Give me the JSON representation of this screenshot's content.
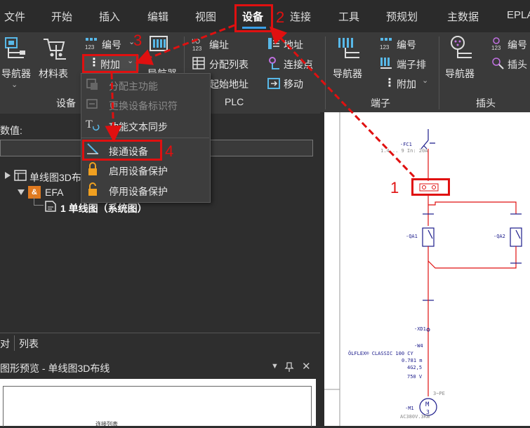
{
  "menubar": {
    "items": [
      "文件",
      "开始",
      "插入",
      "编辑",
      "视图",
      "设备",
      "连接",
      "工具",
      "预规划",
      "主数据",
      "EPLA"
    ],
    "active": "设备"
  },
  "ribbon": {
    "device_group": {
      "navigator": "导航器",
      "bom": "材料表",
      "numbering": "编号",
      "additional": "附加",
      "label": "设备"
    },
    "plc_group": {
      "navigator": "导航器",
      "address": "编址",
      "assign_list": "分配列表",
      "start_address": "起始地址",
      "address2": "地址",
      "connection_point": "连接点",
      "move": "移动",
      "label": "PLC"
    },
    "terminal_group": {
      "navigator": "导航器",
      "numbering": "编号",
      "terminal_strip": "端子排",
      "additional": "附加",
      "label": "端子"
    },
    "plug_group": {
      "navigator": "导航器",
      "numbering": "编号",
      "plug_head": "插头",
      "label": "插头"
    }
  },
  "dropdown": {
    "items": [
      {
        "label": "分配主功能",
        "enabled": false
      },
      {
        "label": "更换设备标识符",
        "enabled": false
      },
      {
        "label": "功能文本同步",
        "enabled": true
      },
      {
        "label": "接通设备",
        "enabled": true
      },
      {
        "label": "启用设备保护",
        "enabled": true
      },
      {
        "label": "停用设备保护",
        "enabled": true
      }
    ]
  },
  "leftpanel": {
    "value_label": "数值:",
    "tree": [
      {
        "label": "单线图3D布"
      },
      {
        "label": "EFA"
      },
      {
        "label": "1 单线图（系统图）"
      }
    ],
    "tabs": [
      "对",
      "列表"
    ]
  },
  "preview": {
    "title": "图形预览 - 单线图3D布线",
    "body_text": "连接列表"
  },
  "drawing": {
    "fc1": "-FC1",
    "fc1_spec": "1.4... 9 In: 20A",
    "qa1": "-QA1",
    "qa2": "-QA2",
    "xd1": "-XD1",
    "w4": "-W4",
    "cable_type": "ÖLFLEX® CLASSIC 100 CY",
    "cable_len": "0.781 m",
    "cable_cores": "4G2,5",
    "cable_voltage": "750 V",
    "m1": "-M1",
    "m1_spec": "AC380V.3KW",
    "motor_label": "M",
    "motor_phase": "3",
    "pe_label": "3~PE"
  },
  "annotations": {
    "n1": "1",
    "n2": "2",
    "n3": "3",
    "n4": "4",
    "color": "#e01010"
  }
}
